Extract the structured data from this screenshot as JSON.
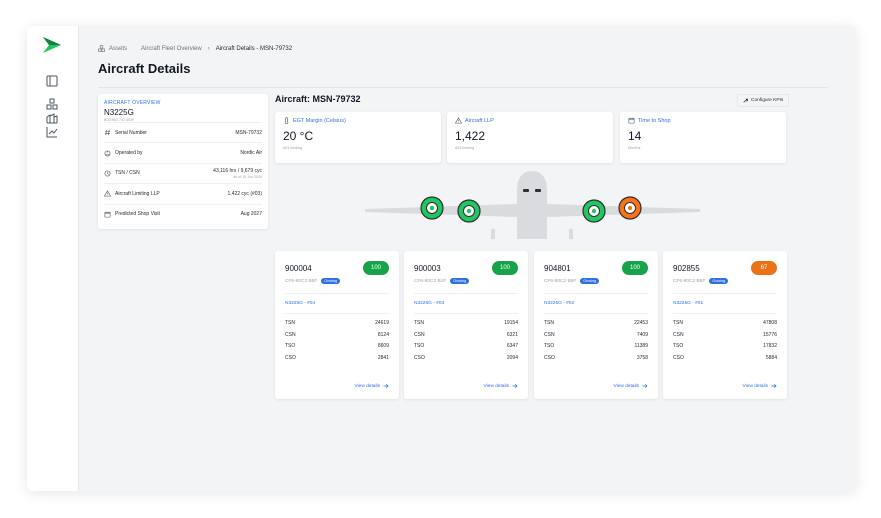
{
  "breadcrumb": {
    "items": [
      "Assets",
      "Aircraft Fleet Overview"
    ],
    "current": "Aircraft Details - MSN-79732"
  },
  "page": {
    "title": "Aircraft Details"
  },
  "overview": {
    "heading": "AIRCRAFT OVERVIEW",
    "registration": "N3225G",
    "model": "BOEING 747-400F",
    "rows": [
      {
        "label": "Serial Number",
        "value": "MSN-79732",
        "sub": "",
        "icon": "hash-icon"
      },
      {
        "label": "Operated by",
        "value": "Nordic Air",
        "sub": "",
        "icon": "operator-icon"
      },
      {
        "label": "TSN / CSN",
        "value": "43,116 hrs / 9,679 cyc",
        "sub": "as of 15 Jun 2026",
        "icon": "clock-icon"
      },
      {
        "label": "Aircraft Limiting LLP",
        "value": "1,422 cyc (#03)",
        "sub": "",
        "icon": "warning-icon"
      },
      {
        "label": "Predicted Shop Visit",
        "value": "Aug 2027",
        "sub": "",
        "icon": "calendar-icon"
      }
    ]
  },
  "aircraft": {
    "title": "Aircraft: MSN-79732",
    "configure_label": "Configure KPIs"
  },
  "kpis": [
    {
      "label": "EGT Margin (Celsius)",
      "value": "20 °C",
      "sub": "#01 limiting",
      "icon": "thermometer-icon"
    },
    {
      "label": "Aircraft LLP",
      "value": "1,422",
      "sub": "#03 limiting",
      "icon": "warning-icon"
    },
    {
      "label": "Time to Shop",
      "value": "14",
      "sub": "Months",
      "icon": "calendar-icon"
    }
  ],
  "engine_status_colors": [
    "#22c55e",
    "#22c55e",
    "#22c55e",
    "#f97316"
  ],
  "engines": [
    {
      "esn": "900004",
      "score": "100",
      "score_color": "#16a34a",
      "type": "CF6-80C2 B5F",
      "status": "Onwing",
      "position": "N3225G - #04",
      "metrics": [
        {
          "k": "TSN",
          "v": "24619"
        },
        {
          "k": "CSN",
          "v": "8124"
        },
        {
          "k": "TSO",
          "v": "8609"
        },
        {
          "k": "CSO",
          "v": "2841"
        }
      ],
      "link": "View details"
    },
    {
      "esn": "900003",
      "score": "100",
      "score_color": "#16a34a",
      "type": "CF6-80C2 B1F",
      "status": "Onwing",
      "position": "N3225G - #03",
      "metrics": [
        {
          "k": "TSN",
          "v": "19154"
        },
        {
          "k": "CSN",
          "v": "6321"
        },
        {
          "k": "TSO",
          "v": "6347"
        },
        {
          "k": "CSO",
          "v": "2094"
        }
      ],
      "link": "View details"
    },
    {
      "esn": "904801",
      "score": "100",
      "score_color": "#16a34a",
      "type": "CF6-80C2 B5F",
      "status": "Onwing",
      "position": "N3225G - #02",
      "metrics": [
        {
          "k": "TSN",
          "v": "22453"
        },
        {
          "k": "CSN",
          "v": "7409"
        },
        {
          "k": "TSO",
          "v": "11389"
        },
        {
          "k": "CSO",
          "v": "3758"
        }
      ],
      "link": "View details"
    },
    {
      "esn": "902855",
      "score": "67",
      "score_color": "#ea7317",
      "type": "CF6-80C2 B5F",
      "status": "Onwing",
      "position": "N3225G - #01",
      "metrics": [
        {
          "k": "TSN",
          "v": "47808"
        },
        {
          "k": "CSN",
          "v": "15776"
        },
        {
          "k": "TSO",
          "v": "17832"
        },
        {
          "k": "CSO",
          "v": "5884"
        }
      ],
      "link": "View details"
    }
  ]
}
